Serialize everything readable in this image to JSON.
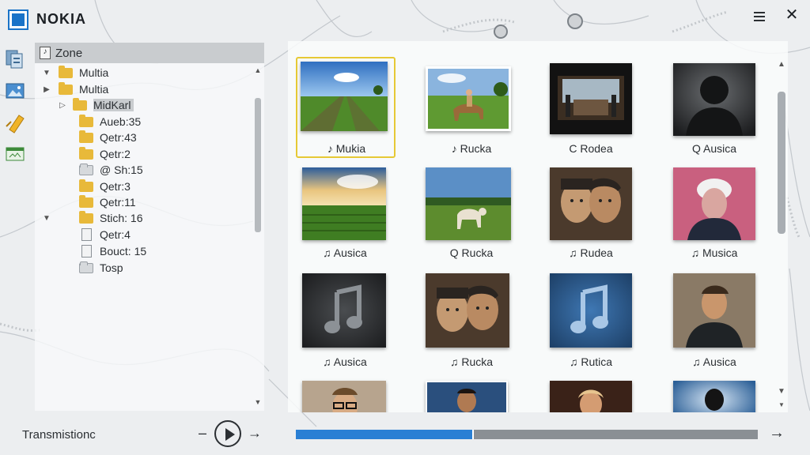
{
  "header": {
    "brand": "NOKIA",
    "menu_icon": "hamburger-menu-icon",
    "close_glyph": "✕"
  },
  "rail": {
    "icons": [
      "library-icon",
      "photo-icon",
      "note-icon",
      "card-icon"
    ]
  },
  "tree": {
    "root": "Zone",
    "items": [
      {
        "label": "Multia",
        "icon": "folder",
        "arrow": "▼"
      },
      {
        "label": "Multia",
        "icon": "folder",
        "arrow": "▶"
      },
      {
        "label": "MidKarl",
        "icon": "folder",
        "arrow": "▷"
      },
      {
        "label": "Aueb:35",
        "icon": "folder",
        "arrow": ""
      },
      {
        "label": "Qetr:43",
        "icon": "folder",
        "arrow": ""
      },
      {
        "label": "Qetr:2",
        "icon": "folder",
        "arrow": ""
      },
      {
        "label": "@ Sh:15",
        "icon": "folder-grey",
        "arrow": ""
      },
      {
        "label": "Qetr:3",
        "icon": "folder",
        "arrow": ""
      },
      {
        "label": "Qetr:11",
        "icon": "folder",
        "arrow": ""
      },
      {
        "label": "Stich: 16",
        "icon": "folder",
        "arrow": ""
      },
      {
        "label": "Qetr:4",
        "icon": "file",
        "arrow": ""
      },
      {
        "label": "Bouct: 15",
        "icon": "folder-grey",
        "arrow": ""
      },
      {
        "label": "Tosp",
        "icon": "folder-grey",
        "arrow": ""
      }
    ]
  },
  "grid": {
    "tiles": [
      {
        "label": "♪ Mukia",
        "art": "field",
        "selected": true
      },
      {
        "label": "♪ Rucka",
        "art": "horse",
        "selected": false
      },
      {
        "label": "C Rodea",
        "art": "concert",
        "selected": false
      },
      {
        "label": "Q Ausica",
        "art": "silhouette",
        "selected": false
      },
      {
        "label": "♫ Ausica",
        "art": "sunset-field",
        "selected": false
      },
      {
        "label": "Q Rucka",
        "art": "goat",
        "selected": false
      },
      {
        "label": "♫ Rudea",
        "art": "duo-faces",
        "selected": false
      },
      {
        "label": "♫ Musica",
        "art": "pink-portrait",
        "selected": false
      },
      {
        "label": "♫ Ausica",
        "art": "music-note-dark",
        "selected": false
      },
      {
        "label": "♫ Rucka",
        "art": "duo-faces-2",
        "selected": false
      },
      {
        "label": "♫ Rutica",
        "art": "music-note-blue",
        "selected": false
      },
      {
        "label": "♫ Ausica",
        "art": "man-portrait",
        "selected": false
      },
      {
        "label": "",
        "art": "glasses-man",
        "selected": false
      },
      {
        "label": "",
        "art": "blue-portrait",
        "selected": false
      },
      {
        "label": "",
        "art": "warm-portrait",
        "selected": false
      },
      {
        "label": "",
        "art": "dark-figure",
        "selected": false
      }
    ]
  },
  "bottom": {
    "status_label": "Transmistionc",
    "minus_glyph": "–",
    "next_glyph": "→",
    "end_glyph": "→",
    "progress": 0.385
  },
  "colors": {
    "accent": "#2a7fd4",
    "selection": "#e6c935",
    "brand_blue": "#1a73c8"
  }
}
